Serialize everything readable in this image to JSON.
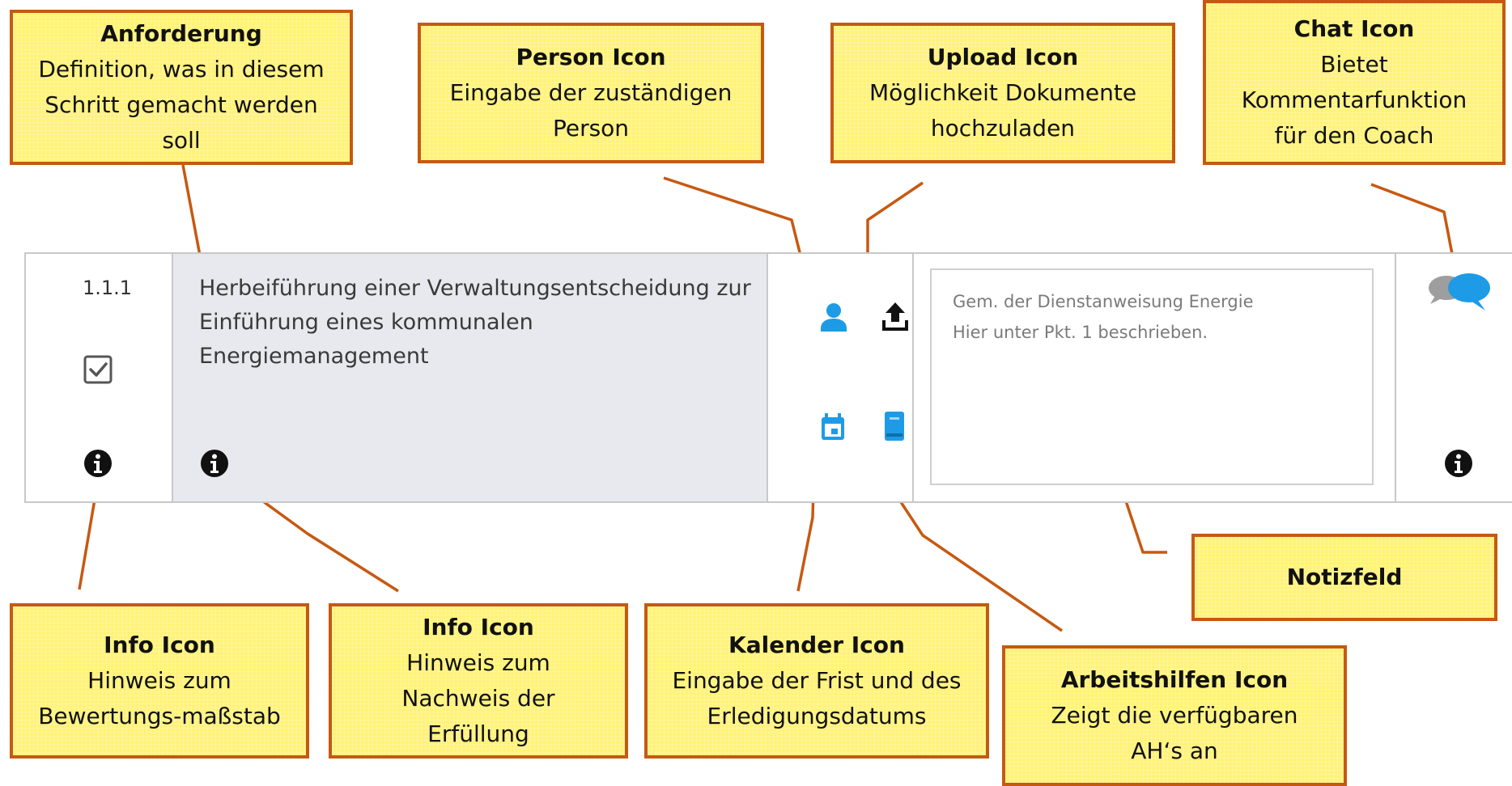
{
  "row": {
    "number": "1.1.1",
    "requirement": "Herbeiführung einer Verwaltungsentscheidung zur Einführung eines kommunalen Energiemanagement",
    "note": "Gem. der Dienstanweisung Energie\nHier unter Pkt. 1 beschrieben."
  },
  "icons": {
    "checkbox": "checkbox-checked-icon",
    "info": "info-icon",
    "person": "person-icon",
    "upload": "upload-icon",
    "calendar": "calendar-icon",
    "book": "book-icon",
    "chat": "chat-icon"
  },
  "colors": {
    "accent_blue": "#1e9be6",
    "callout_fill": "#fff279",
    "callout_border": "#c65911",
    "leader_line": "#c65911",
    "requirement_bg": "#e7e9ee"
  },
  "callouts": {
    "anforderung": {
      "title": "Anforderung",
      "desc": "Definition, was in diesem\nSchritt gemacht werden\nsoll"
    },
    "person": {
      "title": "Person Icon",
      "desc": "Eingabe der zuständigen\nPerson"
    },
    "upload": {
      "title": "Upload Icon",
      "desc": "Möglichkeit Dokumente\nhochzuladen"
    },
    "chat": {
      "title": "Chat Icon",
      "desc": "Bietet\nKommentarfunktion\nfür den Coach"
    },
    "info1": {
      "title": "Info Icon",
      "desc": "Hinweis zum\nBewertungs-maßstab"
    },
    "info2": {
      "title": "Info Icon",
      "desc": "Hinweis zum\nNachweis der\nErfüllung"
    },
    "kalender": {
      "title": "Kalender Icon",
      "desc": "Eingabe der Frist und des\nErledigungsdatums"
    },
    "notiz": {
      "title": "Notizfeld",
      "desc": ""
    },
    "arbeitshilfen": {
      "title": "Arbeitshilfen Icon",
      "desc": "Zeigt die verfügbaren\nAH‘s an"
    }
  }
}
